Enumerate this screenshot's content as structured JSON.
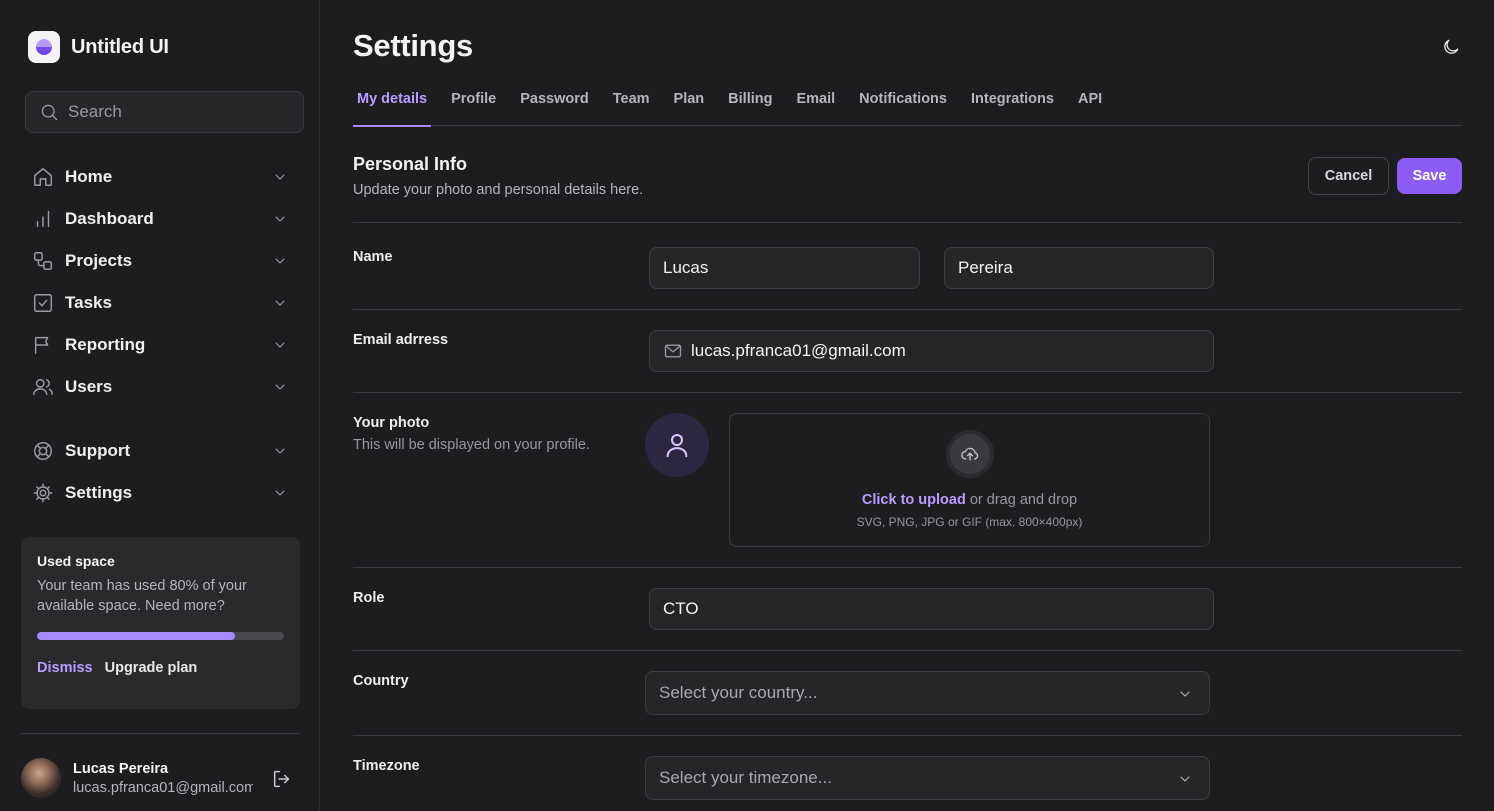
{
  "app": {
    "name": "Untitled UI"
  },
  "search": {
    "placeholder": "Search"
  },
  "sidebar": {
    "items": [
      {
        "label": "Home",
        "icon": "home-icon"
      },
      {
        "label": "Dashboard",
        "icon": "bar-chart-icon"
      },
      {
        "label": "Projects",
        "icon": "layers-icon"
      },
      {
        "label": "Tasks",
        "icon": "check-square-icon"
      },
      {
        "label": "Reporting",
        "icon": "flag-icon"
      },
      {
        "label": "Users",
        "icon": "users-icon"
      }
    ],
    "footer_items": [
      {
        "label": "Support",
        "icon": "life-buoy-icon"
      },
      {
        "label": "Settings",
        "icon": "gear-icon"
      }
    ],
    "used_space": {
      "title": "Used space",
      "text": "Your team has used 80% of your available space. Need more?",
      "percent": 80,
      "dismiss": "Dismiss",
      "upgrade": "Upgrade plan"
    },
    "account": {
      "name": "Lucas Pereira",
      "email": "lucas.pfranca01@gmail.com"
    }
  },
  "page": {
    "title": "Settings"
  },
  "tabs": [
    "My details",
    "Profile",
    "Password",
    "Team",
    "Plan",
    "Billing",
    "Email",
    "Notifications",
    "Integrations",
    "API"
  ],
  "active_tab": "My details",
  "section": {
    "title": "Personal Info",
    "subtitle": "Update your photo and personal details here.",
    "cancel": "Cancel",
    "save": "Save"
  },
  "form": {
    "name": {
      "label": "Name",
      "first": "Lucas",
      "last": "Pereira"
    },
    "email": {
      "label": "Email adrress",
      "value": "lucas.pfranca01@gmail.com"
    },
    "photo": {
      "label": "Your photo",
      "hint": "This will be displayed on your profile.",
      "upload_link": "Click to upload",
      "upload_text": " or drag and drop",
      "upload_hint": "SVG, PNG, JPG or GIF (max. 800×400px)"
    },
    "role": {
      "label": "Role",
      "value": "CTO"
    },
    "country": {
      "label": "Country",
      "placeholder": "Select your country..."
    },
    "timezone": {
      "label": "Timezone",
      "placeholder": "Select your timezone..."
    }
  },
  "colors": {
    "accent": "#8b5cf6",
    "accent_text": "#b89cff",
    "background": "#1d1d1f"
  }
}
